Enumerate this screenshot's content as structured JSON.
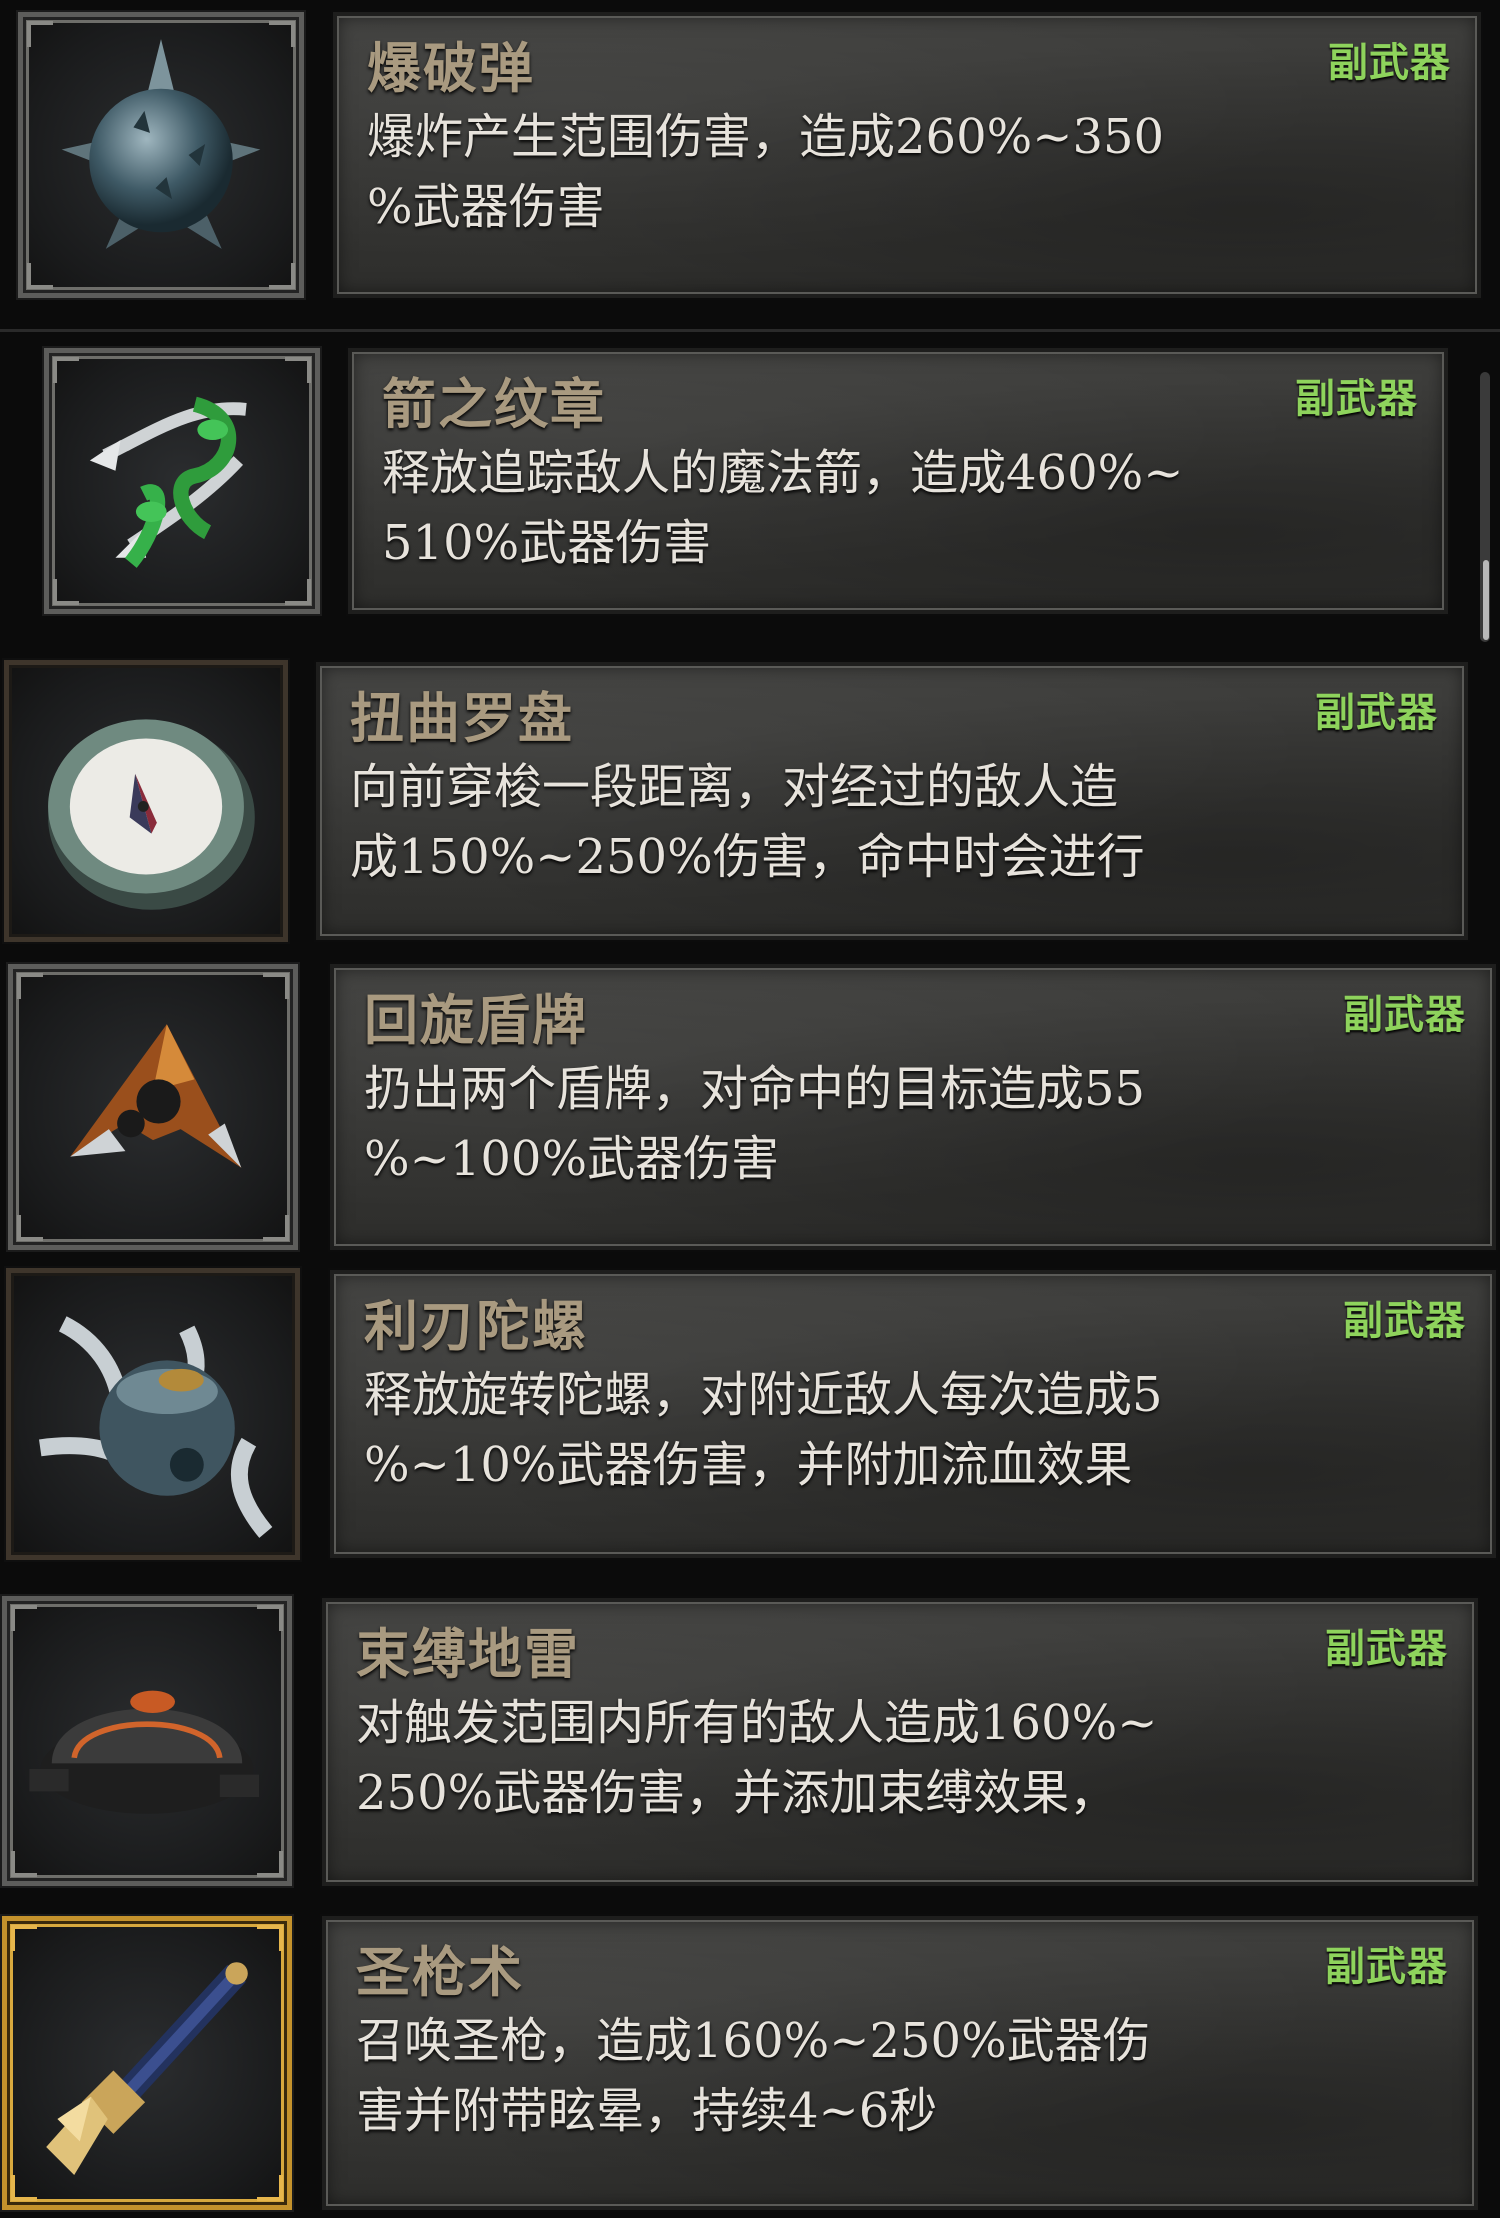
{
  "items": [
    {
      "title": "爆破弹",
      "tag": "副武器",
      "desc_lines": [
        "爆炸产生范围伤害，造成260%~350",
        "%武器伤害"
      ],
      "icon": "spiked-mine-icon"
    },
    {
      "title": "箭之纹章",
      "tag": "副武器",
      "desc_lines": [
        "释放追踪敌人的魔法箭，造成460%~",
        "510%武器伤害"
      ],
      "icon": "arrow-emblem-icon"
    },
    {
      "title": "扭曲罗盘",
      "tag": "副武器",
      "desc_lines": [
        "向前穿梭一段距离，对经过的敌人造",
        "成150%~250%伤害，命中时会进行"
      ],
      "icon": "compass-icon"
    },
    {
      "title": "回旋盾牌",
      "tag": "副武器",
      "desc_lines": [
        "扔出两个盾牌，对命中的目标造成55",
        "%~100%武器伤害"
      ],
      "icon": "boomerang-shield-icon"
    },
    {
      "title": "利刃陀螺",
      "tag": "副武器",
      "desc_lines": [
        "释放旋转陀螺，对附近敌人每次造成5",
        "%~10%武器伤害，并附加流血效果"
      ],
      "icon": "blade-top-icon"
    },
    {
      "title": "束缚地雷",
      "tag": "副武器",
      "desc_lines": [
        "对触发范围内所有的敌人造成160%~",
        "250%武器伤害，并添加束缚效果，"
      ],
      "icon": "binding-mine-icon"
    },
    {
      "title": "圣枪术",
      "tag": "副武器",
      "desc_lines": [
        "召唤圣枪，造成160%~250%武器伤",
        "害并附带眩晕，持续4~6秒"
      ],
      "icon": "holy-spear-icon"
    }
  ],
  "colors": {
    "title": "#a99a80",
    "tag": "#8ed35c",
    "desc": "#e7e3dc",
    "background": "#0b0b0b"
  }
}
